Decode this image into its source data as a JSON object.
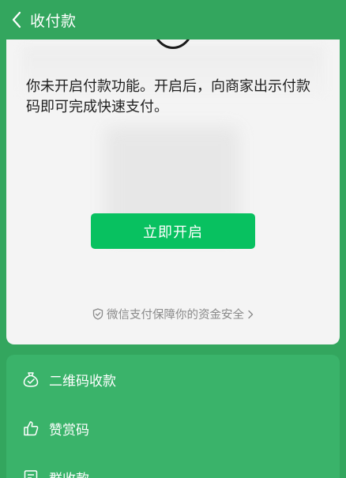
{
  "header": {
    "title": "收付款"
  },
  "card": {
    "notice": "你未开启付款功能。开启后，向商家出示付款码即可完成快速支付。",
    "open_button": "立即开启",
    "security_text": "微信支付保障你的资金安全"
  },
  "menu": {
    "items": [
      {
        "label": "二维码收款",
        "icon": "money-bag-icon"
      },
      {
        "label": "赞赏码",
        "icon": "thumbs-up-icon"
      },
      {
        "label": "群收款",
        "icon": "group-receipt-icon"
      }
    ]
  },
  "colors": {
    "background": "#33a65e",
    "primary_button": "#08c160",
    "card": "#f4f4f4",
    "menu": "#3ab36a"
  }
}
